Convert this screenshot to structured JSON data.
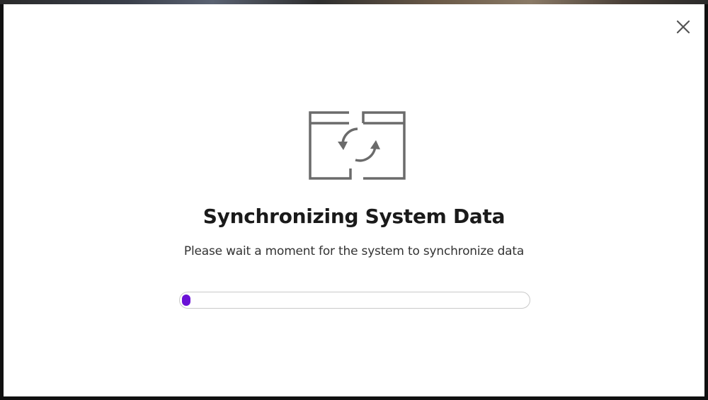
{
  "dialog": {
    "title": "Synchronizing System Data",
    "subtitle": "Please wait a moment for the system to synchronize data",
    "icon": "sync-windows-icon",
    "close_icon": "close-icon",
    "progress": {
      "percent": 2,
      "fill_color": "#6a11d6",
      "track_border_color": "#c9c9c9"
    }
  }
}
